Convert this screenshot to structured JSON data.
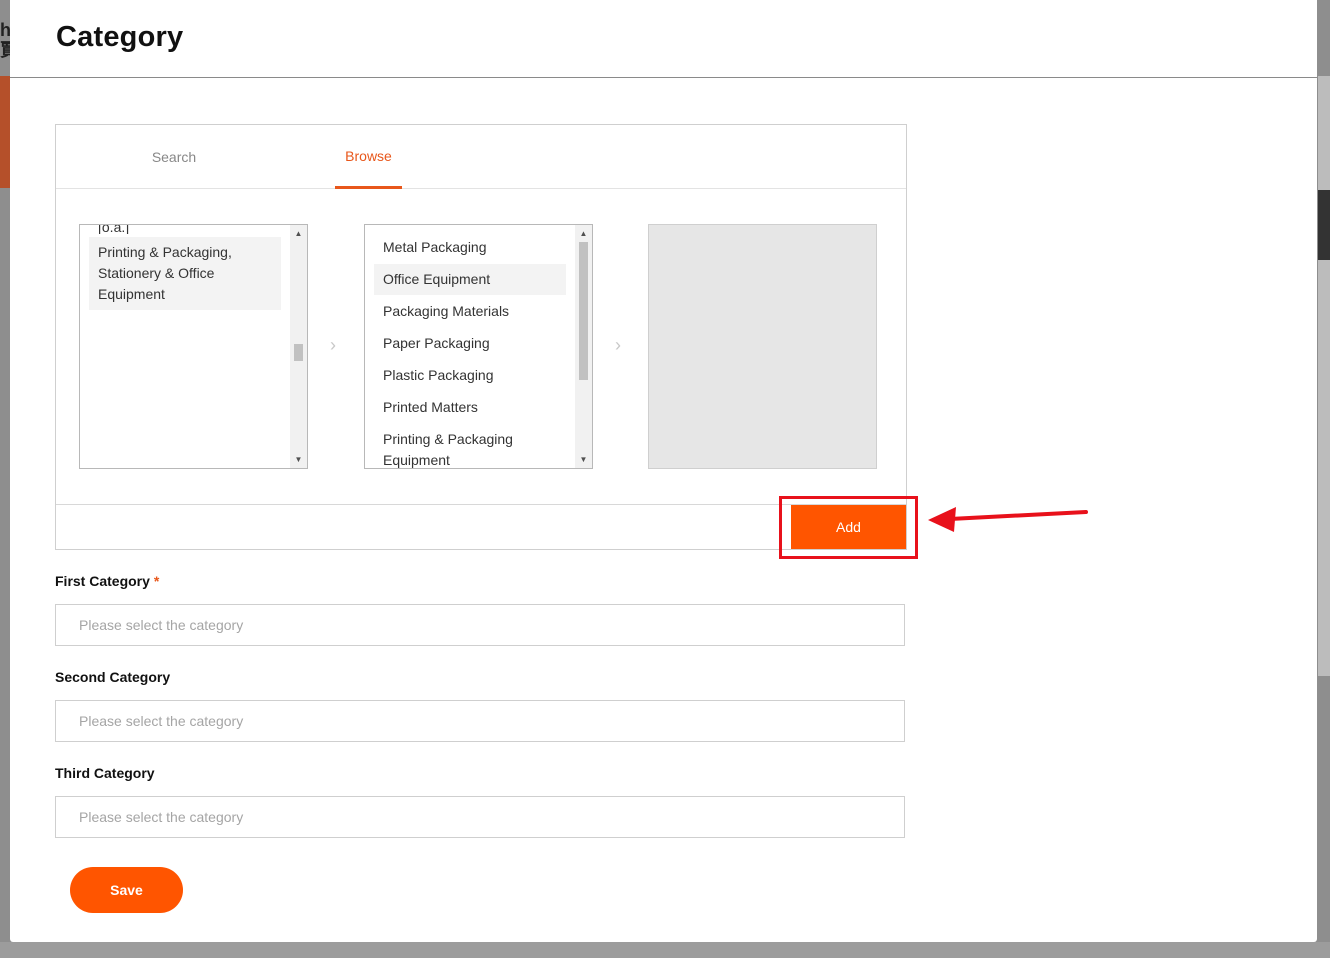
{
  "background": {
    "logo_glyphs": "h\n賈"
  },
  "modal": {
    "title": "Category"
  },
  "tabs": [
    {
      "label": "Search",
      "active": false
    },
    {
      "label": "Browse",
      "active": true
    }
  ],
  "browse": {
    "level1": {
      "clipped_item": "[o.a.]",
      "items": [
        {
          "label": "Printing & Packaging, Stationery & Office Equipment",
          "selected": true
        }
      ]
    },
    "level2": {
      "items": [
        {
          "label": "Metal Packaging",
          "selected": false
        },
        {
          "label": "Office Equipment",
          "selected": true
        },
        {
          "label": "Packaging Materials",
          "selected": false
        },
        {
          "label": "Paper Packaging",
          "selected": false
        },
        {
          "label": "Plastic Packaging",
          "selected": false
        },
        {
          "label": "Printed Matters",
          "selected": false
        },
        {
          "label": "Printing & Packaging Equipment",
          "selected": false
        }
      ]
    },
    "level3": {
      "items": []
    },
    "add_label": "Add"
  },
  "form": {
    "first": {
      "label": "First Category",
      "required_mark": "*",
      "placeholder": "Please select the category",
      "value": ""
    },
    "second": {
      "label": "Second Category",
      "placeholder": "Please select the category",
      "value": ""
    },
    "third": {
      "label": "Third Category",
      "placeholder": "Please select the category",
      "value": ""
    },
    "save_label": "Save"
  },
  "colors": {
    "accent": "#ff5500",
    "tab_active": "#e8571b",
    "annotation": "#e8111b"
  }
}
